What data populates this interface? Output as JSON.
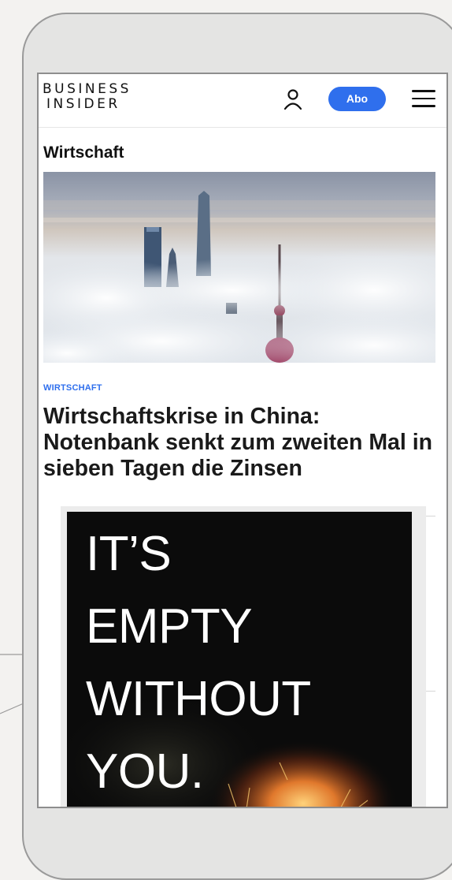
{
  "header": {
    "logo_line1": "BUSINESS",
    "logo_line2": "INSIDER",
    "user_icon": "user-icon",
    "subscribe_label": "Abo",
    "menu_icon": "hamburger-menu-icon"
  },
  "section": {
    "title": "Wirtschaft"
  },
  "article": {
    "image_icon": "city-skyline-in-fog-photo",
    "category": "WIRTSCHAFT",
    "headline": "Wirtschaftskrise in China: Notenbank senkt zum zweiten Mal in sieben Tagen die Zinsen"
  },
  "ad": {
    "text": "IT’S\nEMPTY\nWITHOUT\nYOU."
  },
  "colors": {
    "accent": "#2f6fed",
    "text": "#1a1a1a",
    "ad_background": "#0b0b0b"
  }
}
